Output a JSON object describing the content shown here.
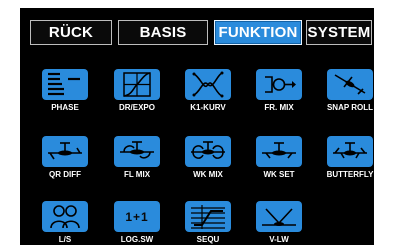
{
  "tabs": [
    {
      "label": "RÜCK"
    },
    {
      "label": "BASIS"
    },
    {
      "label": "FUNKTION",
      "active": true
    },
    {
      "label": "SYSTEM"
    }
  ],
  "tiles": [
    {
      "label": "PHASE",
      "icon": "phase-bars-icon"
    },
    {
      "label": "DR/EXPO",
      "icon": "expo-curve-icon"
    },
    {
      "label": "K1-KURV",
      "icon": "channel-curve-icon"
    },
    {
      "label": "FR. MIX",
      "icon": "free-mixer-icon"
    },
    {
      "label": "SNAP ROLL",
      "icon": "snap-roll-icon"
    },
    {
      "label": "QR DIFF",
      "icon": "aileron-diff-icon"
    },
    {
      "label": "FL MIX",
      "icon": "flap-mix-icon"
    },
    {
      "label": "WK MIX",
      "icon": "wing-mix-icon"
    },
    {
      "label": "WK SET",
      "icon": "wing-set-icon"
    },
    {
      "label": "BUTTERFLY",
      "icon": "butterfly-icon"
    },
    {
      "label": "L/S",
      "icon": "teacher-student-icon"
    },
    {
      "label": "LOG.SW",
      "icon": "logic-switch-icon",
      "glyph": "1+1"
    },
    {
      "label": "SEQU",
      "icon": "sequencer-icon"
    },
    {
      "label": "V-LW",
      "icon": "v-tail-icon"
    }
  ],
  "colors": {
    "accent": "#2a8bdc",
    "background": "#000000",
    "text": "#ffffff"
  }
}
